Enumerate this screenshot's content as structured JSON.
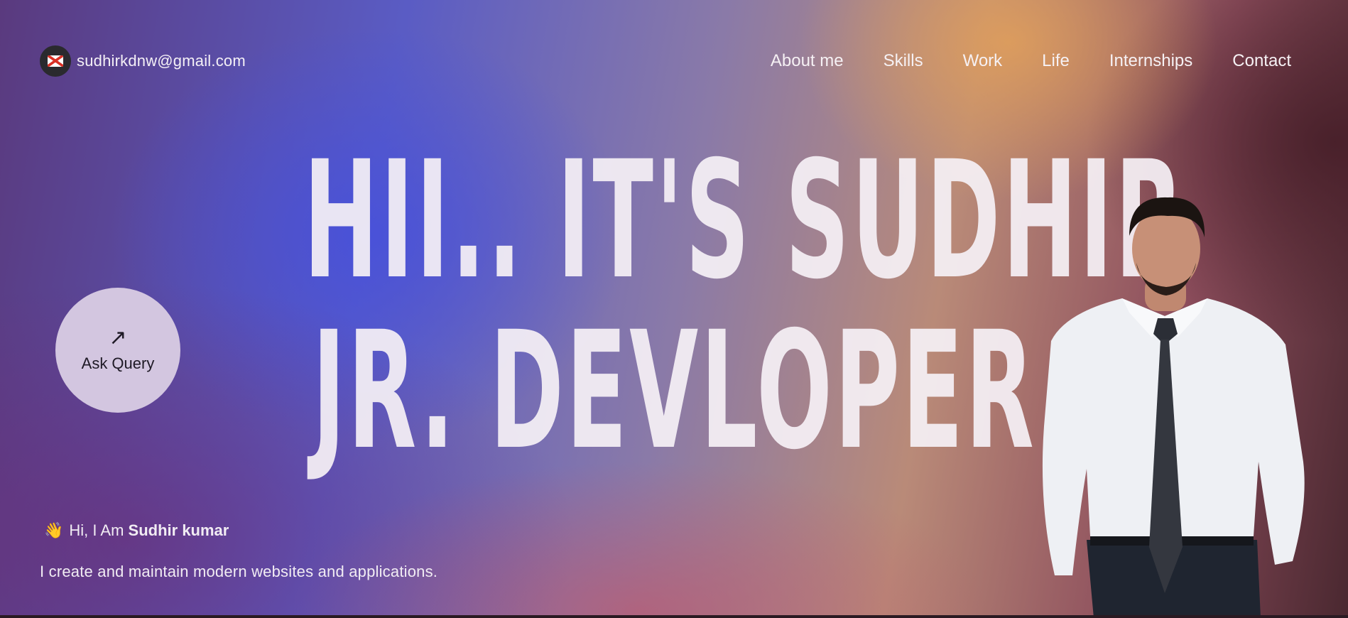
{
  "header": {
    "email": "sudhirkdnw@gmail.com",
    "mail_icon": "gmail-icon",
    "nav": [
      {
        "label": "About me"
      },
      {
        "label": "Skills"
      },
      {
        "label": "Work"
      },
      {
        "label": "Life"
      },
      {
        "label": "Internships"
      },
      {
        "label": "Contact"
      }
    ]
  },
  "hero": {
    "line1": "HII.. IT'S SUDHIR",
    "line2": "JR. DEVLOPER"
  },
  "query_button": {
    "arrow": "↗",
    "label": "Ask Query"
  },
  "intro": {
    "wave": "👋",
    "prefix": "Hi, I Am",
    "name": "Sudhir kumar",
    "tagline": "I create and maintain modern websites and applications."
  },
  "colors": {
    "accent_button": "#d3c6e0",
    "text": "#f3eef6"
  }
}
